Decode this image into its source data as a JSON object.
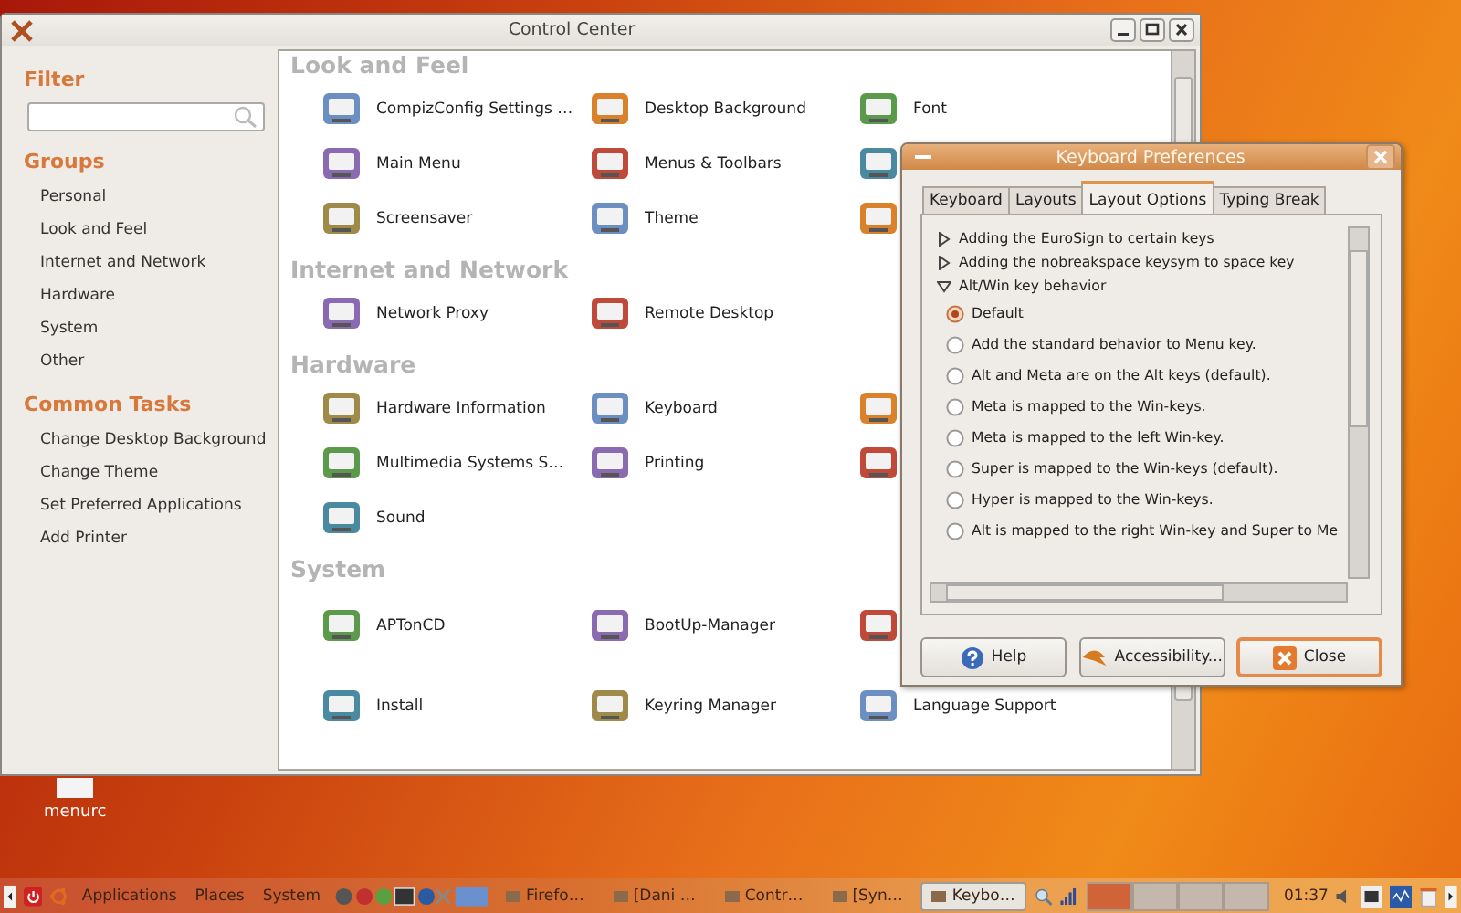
{
  "desktop_icons": [
    {
      "label": "menurc"
    }
  ],
  "control_center": {
    "title": "Control Center",
    "sidebar": [
      {
        "kind": "search",
        "heading": "Filter"
      },
      {
        "kind": "links",
        "heading": "Groups",
        "items": [
          "Personal",
          "Look and Feel",
          "Internet and Network",
          "Hardware",
          "System",
          "Other"
        ]
      },
      {
        "kind": "links",
        "heading": "Common Tasks",
        "items": [
          "Change Desktop Background",
          "Change Theme",
          "Set Preferred Applications",
          "Add Printer"
        ]
      }
    ],
    "sections": [
      {
        "heading": "Look and Feel",
        "rows": [
          [
            {
              "kind": "launcher",
              "label": "CompizConfig Settings …"
            },
            {
              "kind": "launcher",
              "label": "Desktop Background"
            },
            {
              "kind": "launcher",
              "label": "Font"
            }
          ],
          [
            {
              "kind": "launcher",
              "label": "Main Menu"
            },
            {
              "kind": "launcher",
              "label": "Menus & Toolbars"
            },
            {
              "kind": "icon-only"
            }
          ],
          [
            {
              "kind": "launcher",
              "label": "Screensaver"
            },
            {
              "kind": "launcher",
              "label": "Theme"
            },
            {
              "kind": "icon-only"
            }
          ]
        ]
      },
      {
        "heading": "Internet and Network",
        "rows": [
          [
            {
              "kind": "launcher",
              "label": "Network Proxy"
            },
            {
              "kind": "launcher",
              "label": "Remote Desktop"
            }
          ]
        ]
      },
      {
        "heading": "Hardware",
        "rows": [
          [
            {
              "kind": "launcher",
              "label": "Hardware Information"
            },
            {
              "kind": "launcher",
              "label": "Keyboard"
            },
            {
              "kind": "icon-only"
            }
          ],
          [
            {
              "kind": "launcher",
              "label": "Multimedia Systems S…"
            },
            {
              "kind": "launcher",
              "label": "Printing"
            },
            {
              "kind": "icon-only"
            }
          ],
          [
            {
              "kind": "launcher",
              "label": "Sound"
            }
          ]
        ]
      },
      {
        "heading": "System",
        "rows": [
          [
            {
              "kind": "launcher",
              "label": "APTonCD"
            },
            {
              "kind": "launcher",
              "label": "BootUp-Manager"
            },
            {
              "kind": "icon-only"
            }
          ],
          [
            {
              "kind": "launcher",
              "label": "Install"
            },
            {
              "kind": "launcher",
              "label": "Keyring Manager"
            },
            {
              "kind": "launcher",
              "label": "Language Support"
            }
          ]
        ]
      }
    ]
  },
  "dialog": {
    "title": "Keyboard Preferences",
    "tabs": [
      {
        "label": "Keyboard",
        "selected": false
      },
      {
        "label": "Layouts",
        "selected": false
      },
      {
        "label": "Layout Options",
        "selected": true
      },
      {
        "label": "Typing Break",
        "selected": false
      }
    ],
    "options": [
      {
        "label": "Adding the EuroSign to certain keys",
        "expanded": false
      },
      {
        "label": "Adding the nobreakspace keysym to space key",
        "expanded": false
      },
      {
        "label": "Alt/Win key behavior",
        "expanded": true,
        "choices": [
          {
            "label": "Default",
            "selected": true
          },
          {
            "label": "Add the standard behavior to Menu key.",
            "selected": false
          },
          {
            "label": "Alt and Meta are on the Alt keys (default).",
            "selected": false
          },
          {
            "label": "Meta is mapped to the Win-keys.",
            "selected": false
          },
          {
            "label": "Meta is mapped to the left Win-key.",
            "selected": false
          },
          {
            "label": "Super is mapped to the Win-keys (default).",
            "selected": false
          },
          {
            "label": "Hyper is mapped to the Win-keys.",
            "selected": false
          },
          {
            "label": "Alt is mapped to the right Win-key and Super to Me",
            "selected": false
          }
        ]
      }
    ],
    "buttons": [
      {
        "kind": "help",
        "label": "Help",
        "focused": false
      },
      {
        "kind": "accessibility",
        "label": "Accessibility...",
        "focused": false
      },
      {
        "kind": "close",
        "label": "Close",
        "focused": true
      }
    ]
  },
  "taskbar": {
    "menus": [
      "Applications",
      "Places",
      "System"
    ],
    "tasks": [
      {
        "label": "Firefo…",
        "selected": false
      },
      {
        "label": "[Dani …",
        "selected": false
      },
      {
        "label": "Contr…",
        "selected": false
      },
      {
        "label": "[Syn…",
        "selected": false
      },
      {
        "label": "Keybo…",
        "selected": true
      }
    ],
    "workspaces": [
      {
        "selected": true
      },
      {
        "selected": false
      },
      {
        "selected": false
      },
      {
        "selected": false
      }
    ],
    "clock": "01:37"
  }
}
